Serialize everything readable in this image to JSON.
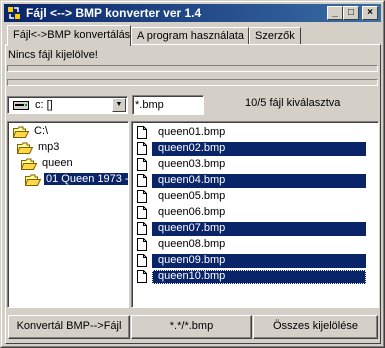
{
  "window": {
    "title": "Fájl <--> BMP  konverter ver 1.4",
    "controls": {
      "minimize": "_",
      "maximize": "□",
      "close": "×"
    }
  },
  "tabs": [
    {
      "label": "Fájl<->BMP konvertálás",
      "active": true
    },
    {
      "label": "A program használata",
      "active": false
    },
    {
      "label": "Szerzők",
      "active": false
    }
  ],
  "status": {
    "message": "Nincs fájl kijelölve!"
  },
  "drive": {
    "value": "c: []",
    "icon": "drive-icon"
  },
  "filter": {
    "value": "*.bmp"
  },
  "selection": {
    "count_label": "10/5 fájl kiválasztva"
  },
  "directories": [
    {
      "label": "C:\\",
      "open": true,
      "selected": false
    },
    {
      "label": "mp3",
      "open": true,
      "selected": false
    },
    {
      "label": "queen",
      "open": true,
      "selected": false
    },
    {
      "label": "01 Queen 1973 -",
      "open": true,
      "selected": true
    }
  ],
  "files": [
    {
      "name": "queen01.bmp",
      "selected": false
    },
    {
      "name": "queen02.bmp",
      "selected": true
    },
    {
      "name": "queen03.bmp",
      "selected": false
    },
    {
      "name": "queen04.bmp",
      "selected": true
    },
    {
      "name": "queen05.bmp",
      "selected": false
    },
    {
      "name": "queen06.bmp",
      "selected": false
    },
    {
      "name": "queen07.bmp",
      "selected": true
    },
    {
      "name": "queen08.bmp",
      "selected": false
    },
    {
      "name": "queen09.bmp",
      "selected": true
    },
    {
      "name": "queen10.bmp",
      "selected": true,
      "focused": true
    }
  ],
  "buttons": {
    "convert": "Konvertál BMP-->Fájl",
    "mask": "*.*/*.bmp",
    "select_all": "Összes kijelölése"
  },
  "colors": {
    "title_bar": "#0a246a",
    "selection": "#0a246a",
    "face": "#d4d0c8"
  }
}
